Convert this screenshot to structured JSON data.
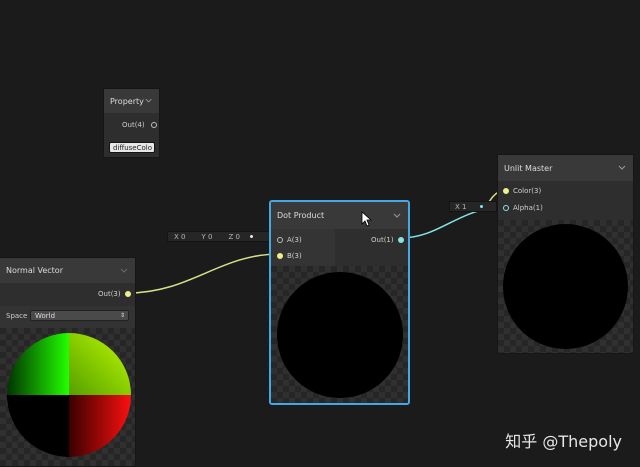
{
  "property_node": {
    "title": "Property",
    "out_label": "Out(4)",
    "value_field": "diffuseColo"
  },
  "dot_product_node": {
    "title": "Dot Product",
    "input_a_label": "A(3)",
    "input_b_label": "B(3)",
    "output_label": "Out(1)",
    "inline_x": "X  0",
    "inline_y": "Y  0",
    "inline_z": "Z  0"
  },
  "normal_vector_node": {
    "title": "Normal Vector",
    "out_label": "Out(3)",
    "space_label": "Space",
    "space_value": "World"
  },
  "unlit_master_node": {
    "title": "Unlit Master",
    "color_label": "Color(3)",
    "alpha_label": "Alpha(1)",
    "alpha_inline": "X  1"
  },
  "watermark": "知乎 @Thepoly",
  "colors": {
    "background": "#1b1b1b",
    "selection_outline": "#44a8e6",
    "vector3_wire": "#d9e08a",
    "float_wire": "#84e4e7"
  }
}
